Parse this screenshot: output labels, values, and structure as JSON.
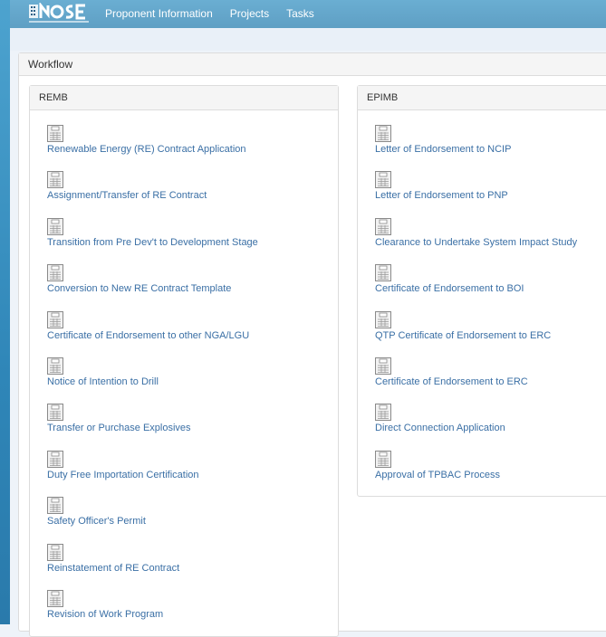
{
  "nav": {
    "logo_icon": "nose-logo",
    "items": [
      "Proponent Information",
      "Projects",
      "Tasks"
    ]
  },
  "workflow": {
    "title": "Workflow",
    "remb": {
      "title": "REMB",
      "items": [
        "Renewable Energy (RE) Contract Application",
        "Assignment/Transfer of RE Contract",
        "Transition from Pre Dev't to Development Stage",
        "Conversion to New RE Contract Template",
        "Certificate of Endorsement to other NGA/LGU",
        "Notice of Intention to Drill",
        "Transfer or Purchase Explosives",
        "Duty Free Importation Certification",
        "Safety Officer's Permit",
        "Reinstatement of RE Contract",
        "Revision of Work Program"
      ]
    },
    "epimb": {
      "title": "EPIMB",
      "items": [
        "Letter of Endorsement to NCIP",
        "Letter of Endorsement to PNP",
        "Clearance to Undertake System Impact Study",
        "Certificate of Endorsement to BOI",
        "QTP Certificate of Endorsement to ERC",
        "Certificate of Endorsement to ERC",
        "Direct Connection Application",
        "Approval of TPBAC Process"
      ]
    }
  },
  "colors": {
    "link": "#3a6fa5",
    "navbar": "#5f9fc4"
  }
}
